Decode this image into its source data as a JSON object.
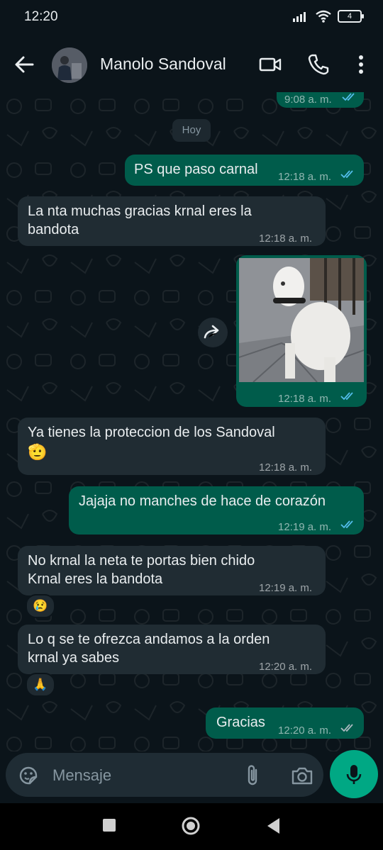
{
  "status": {
    "time": "12:20",
    "battery": "4"
  },
  "header": {
    "contact_name": "Manolo Sandoval"
  },
  "chat": {
    "prev_time": "9:08 a. m.",
    "day_label": "Hoy",
    "messages": [
      {
        "dir": "out",
        "text": "PS que paso carnal",
        "time": "12:18 a. m."
      },
      {
        "dir": "in",
        "line1": "La nta muchas gracias krnal eres la",
        "line2": "bandota",
        "time": "12:18 a. m."
      },
      {
        "dir": "out",
        "type": "image",
        "time": "12:18 a. m."
      },
      {
        "dir": "in",
        "line1": "Ya tienes la proteccion de los Sandoval",
        "emoji": "🫡",
        "time": "12:18 a. m."
      },
      {
        "dir": "out",
        "text": "Jajaja no manches de hace de corazón",
        "time": "12:19 a. m."
      },
      {
        "dir": "in",
        "line1": "No krnal la neta te portas bien chido",
        "line2": "Krnal eres la bandota",
        "time": "12:19 a. m.",
        "reaction": "😢"
      },
      {
        "dir": "in",
        "line1": "Lo q se te ofrezca andamos a la orden",
        "line2": "krnal ya sabes",
        "time": "12:20 a. m.",
        "reaction": "🙏"
      },
      {
        "dir": "out",
        "text": "Gracias",
        "time": "12:20 a. m."
      }
    ]
  },
  "composer": {
    "placeholder": "Mensaje"
  },
  "colors": {
    "outgoing": "#005c4b",
    "incoming": "#202c33",
    "accent": "#00a884",
    "read_ticks": "#53bdeb"
  },
  "icons": [
    "back-arrow-icon",
    "video-call-icon",
    "phone-icon",
    "more-options-icon",
    "forward-icon",
    "sticker-icon",
    "attach-icon",
    "camera-icon",
    "mic-icon",
    "nav-recents-icon",
    "nav-home-icon",
    "nav-back-icon"
  ]
}
